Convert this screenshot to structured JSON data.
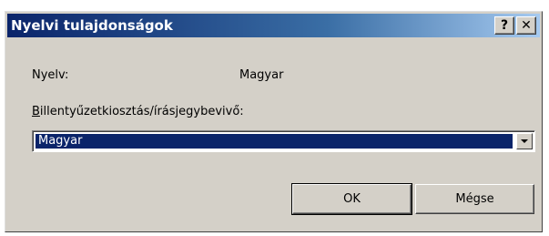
{
  "window": {
    "title": "Nyelvi tulajdonságok",
    "help_label": "?",
    "close_label": "✕"
  },
  "fields": {
    "language_label": "Nyelv:",
    "language_value": "Magyar",
    "keyboard_label_accel": "B",
    "keyboard_label_rest": "illentyűzetkiosztás/írásjegybevivő:",
    "keyboard_selected": "Magyar"
  },
  "buttons": {
    "ok_label": "OK",
    "cancel_label": "Mégse"
  },
  "colors": {
    "title_bar_start": "#0a246a",
    "title_bar_end": "#a6caf0",
    "dialog_face": "#d4d0c8",
    "selection": "#0a246a"
  }
}
